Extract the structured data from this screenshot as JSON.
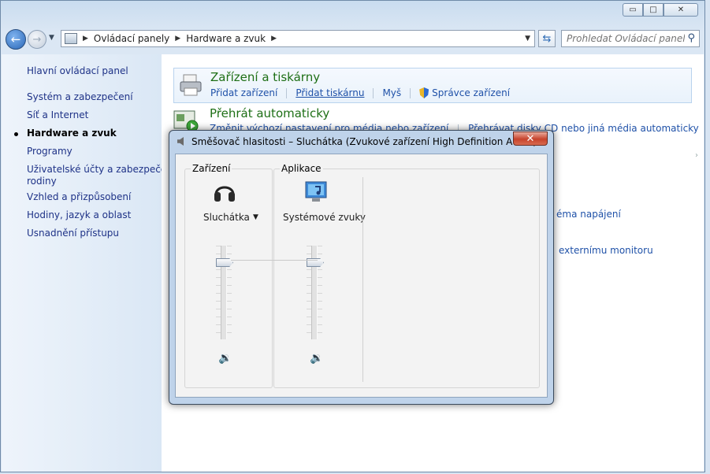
{
  "window": {
    "minimize_label": "▭",
    "maximize_label": "□",
    "close_label": "✕"
  },
  "nav": {
    "back_icon": "arrow-left-icon",
    "forward_icon": "arrow-right-icon"
  },
  "address": {
    "segments": [
      "Ovládací panely",
      "Hardware a zvuk"
    ]
  },
  "search": {
    "placeholder": "Prohledat Ovládací panely"
  },
  "sidebar": {
    "items": [
      {
        "label": "Hlavní ovládací panel",
        "current": false
      },
      {
        "label": "Systém a zabezpečení",
        "current": false
      },
      {
        "label": "Síť a Internet",
        "current": false
      },
      {
        "label": "Hardware a zvuk",
        "current": true
      },
      {
        "label": "Programy",
        "current": false
      },
      {
        "label": "Uživatelské účty a zabezpečení",
        "current": false
      },
      {
        "label": "rodiny",
        "current": false
      },
      {
        "label": "Vzhled a přizpůsobení",
        "current": false
      },
      {
        "label": "Hodiny, jazyk a oblast",
        "current": false
      },
      {
        "label": "Usnadnění přístupu",
        "current": false
      }
    ]
  },
  "categories": {
    "devices": {
      "title": "Zařízení a tiskárny",
      "links": [
        "Přidat zařízení",
        "Přidat tiskárnu",
        "Myš",
        "Správce zařízení"
      ]
    },
    "autoplay": {
      "title": "Přehrát automaticky",
      "links": [
        "Změnit výchozí nastavení pro média nebo zařízení",
        "Přehrávat disky CD nebo jiná média automaticky"
      ]
    },
    "partial_links": [
      "éma napájení",
      "externímu monitoru"
    ]
  },
  "mixer": {
    "title": "Směšovač hlasitosti – Sluchátka (Zvukové zařízení High Definition Audio)",
    "close_label": "✕",
    "device_group_label": "Zařízení",
    "apps_group_label": "Aplikace",
    "device": {
      "name": "Sluchátka",
      "icon": "headphones-icon",
      "volume": 0.85,
      "speaker_icon": "speaker-icon"
    },
    "apps": [
      {
        "name": "Systémové zvuky",
        "icon": "system-sounds-icon",
        "volume": 0.85,
        "speaker_icon": "speaker-icon"
      }
    ]
  }
}
